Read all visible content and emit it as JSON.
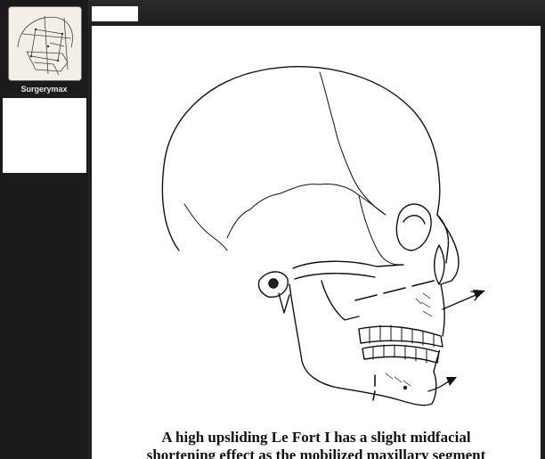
{
  "sidebar": {
    "items": [
      {
        "label": "Surgerymax",
        "selected": true
      },
      {
        "label": "",
        "selected": false
      }
    ]
  },
  "figure": {
    "caption_line1": "A high upsliding Le Fort I has a slight midfacial",
    "caption_line2": "shortening effect as the mobilized maxillary segment"
  }
}
